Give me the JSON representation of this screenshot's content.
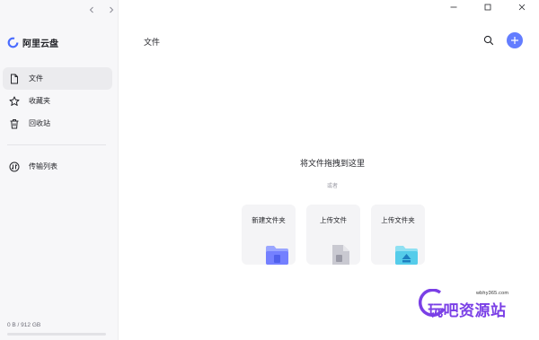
{
  "app": {
    "name": "阿里云盘"
  },
  "sidebar": {
    "items": [
      {
        "label": "文件",
        "icon": "file-icon"
      },
      {
        "label": "收藏夹",
        "icon": "star-icon"
      },
      {
        "label": "回收站",
        "icon": "trash-icon"
      },
      {
        "label": "传输列表",
        "icon": "transfer-icon"
      }
    ],
    "storage": {
      "text": "0 B / 912 GB",
      "used_fraction": 0
    }
  },
  "header": {
    "title": "文件"
  },
  "drop_zone": {
    "title": "将文件拖拽到这里",
    "or_text": "或者",
    "actions": [
      {
        "label": "新建文件夹",
        "icon": "folder-purple-icon"
      },
      {
        "label": "上传文件",
        "icon": "file-grey-icon"
      },
      {
        "label": "上传文件夹",
        "icon": "folder-upload-icon"
      }
    ]
  },
  "watermark": {
    "url": "wbhy365.com",
    "text": "玩吧资源站"
  },
  "colors": {
    "accent": "#637dff",
    "sidebar_bg": "#f7f7f9",
    "card_bg": "#f4f4f6",
    "watermark": "#7a3fe6"
  }
}
